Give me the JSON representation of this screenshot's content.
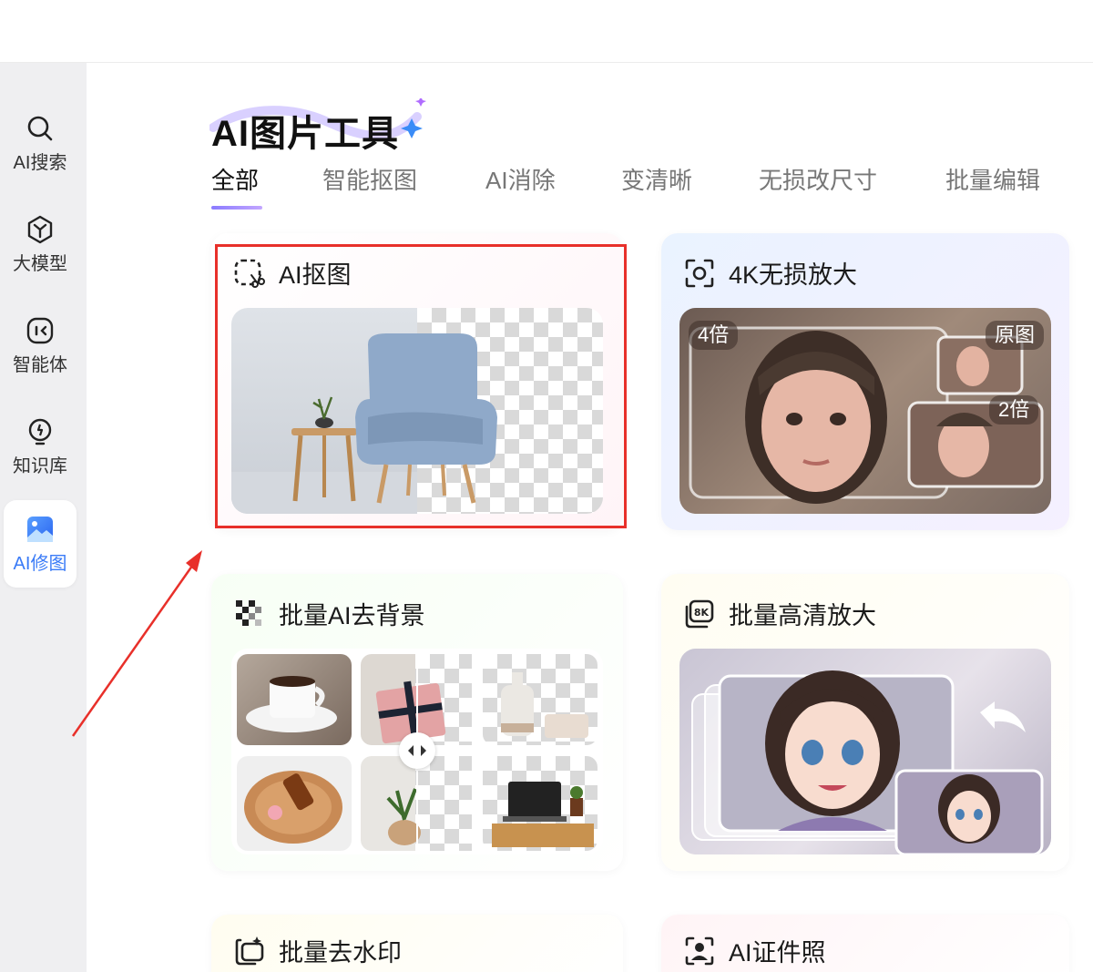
{
  "sidebar": {
    "items": [
      {
        "label": "AI搜索",
        "icon": "search-icon"
      },
      {
        "label": "大模型",
        "icon": "cube-icon"
      },
      {
        "label": "智能体",
        "icon": "agent-icon"
      },
      {
        "label": "知识库",
        "icon": "bulb-icon"
      },
      {
        "label": "AI修图",
        "icon": "image-icon",
        "active": true
      }
    ]
  },
  "header": {
    "title": "AI图片工具"
  },
  "tabs": [
    {
      "label": "全部",
      "active": true
    },
    {
      "label": "智能抠图"
    },
    {
      "label": "AI消除"
    },
    {
      "label": "变清晰"
    },
    {
      "label": "无损改尺寸"
    },
    {
      "label": "批量编辑"
    }
  ],
  "cards": [
    {
      "title": "AI抠图",
      "icon": "cutout-scissors-icon"
    },
    {
      "title": "4K无损放大",
      "icon": "focus-camera-icon",
      "badges": {
        "left": "4倍",
        "original": "原图",
        "double": "2倍"
      }
    },
    {
      "title": "批量AI去背景",
      "icon": "checker-grid-icon"
    },
    {
      "title": "批量高清放大",
      "icon": "8k-badge-icon"
    },
    {
      "title": "批量去水印",
      "icon": "watermark-remove-icon"
    },
    {
      "title": "AI证件照",
      "icon": "id-photo-icon"
    }
  ],
  "colors": {
    "accent": "#3a7bf7",
    "highlight_box": "#e8302a",
    "tab_underline": "#8a7bff"
  }
}
